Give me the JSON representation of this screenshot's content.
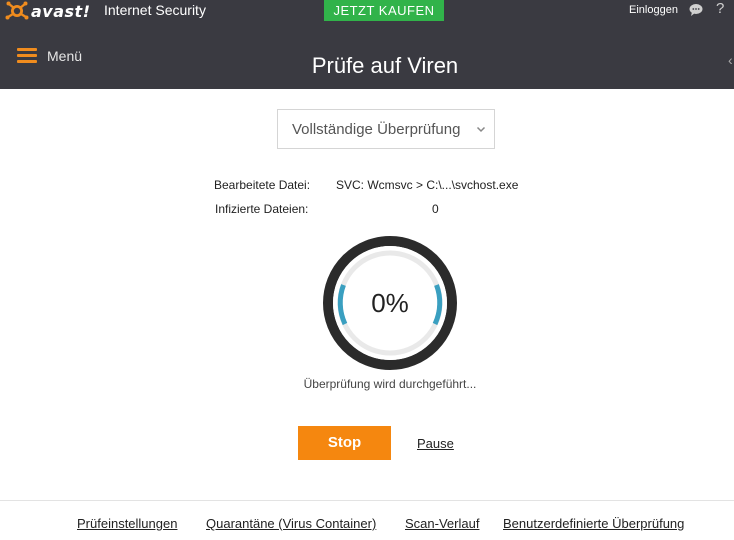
{
  "topbar": {
    "logo_text": "avast!",
    "product_name": "Internet Security",
    "buy_label": "JETZT KAUFEN",
    "login_label": "Einloggen",
    "help_label": "?",
    "chat_icon": "chat-bubble-icon",
    "colors": {
      "bar": "#3a3a41",
      "buy": "#31b34a",
      "accent": "#f08c1e"
    }
  },
  "header": {
    "menu_label": "Menü",
    "title": "Prüfe auf Viren",
    "edge_arrow": "‹"
  },
  "scan": {
    "type_selected": "Vollständige Überprüfung",
    "processed_label": "Bearbeitete Datei:",
    "processed_value": "SVC: Wcmsvc > C:\\...\\svchost.exe",
    "infected_label": "Infizierte Dateien:",
    "infected_value": "0",
    "progress_text": "0%",
    "progress_fraction": 0,
    "status": "Überprüfung wird durchgeführt...",
    "stop_label": "Stop",
    "pause_label": "Pause",
    "colors": {
      "ring_dark": "#2b2b2b",
      "ring_track": "#e9e9e9",
      "ring_accent": "#3a9fc0",
      "stop": "#f5870f"
    }
  },
  "footer": {
    "links": [
      "Prüfeinstellungen",
      "Quarantäne (Virus Container)",
      "Scan-Verlauf",
      "Benutzerdefinierte Überprüfung"
    ]
  }
}
